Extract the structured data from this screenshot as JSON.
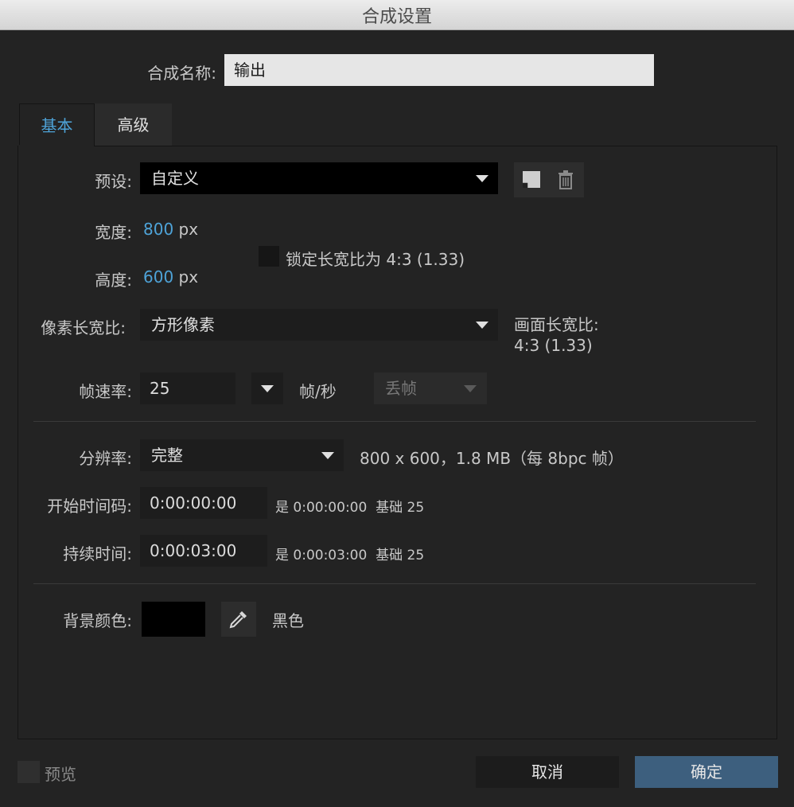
{
  "window": {
    "title": "合成设置"
  },
  "comp_name": {
    "label": "合成名称:",
    "value": "输出"
  },
  "tabs": [
    {
      "label": "基本",
      "active": true
    },
    {
      "label": "高级",
      "active": false
    }
  ],
  "preset": {
    "label": "预设:",
    "value": "自定义",
    "icons": [
      "save-preset-icon",
      "trash-icon"
    ]
  },
  "width": {
    "label": "宽度:",
    "value": "800",
    "unit": "px"
  },
  "height": {
    "label": "高度:",
    "value": "600",
    "unit": "px"
  },
  "lock_aspect": {
    "label": "锁定长宽比为 4:3 (1.33)",
    "checked": false
  },
  "pixel_aspect": {
    "label": "像素长宽比:",
    "value": "方形像素"
  },
  "frame_aspect": {
    "label": "画面长宽比:",
    "value": "4:3 (1.33)"
  },
  "frame_rate": {
    "label": "帧速率:",
    "value": "25",
    "unit": "帧/秒",
    "drop_frame": "丢帧"
  },
  "resolution": {
    "label": "分辨率:",
    "value": "完整",
    "info": "800 x 600，1.8 MB（每 8bpc 帧）"
  },
  "start_timecode": {
    "label": "开始时间码:",
    "value": "0:00:00:00",
    "info_is": "是 0:00:00:00",
    "info_base": "基础 25"
  },
  "duration": {
    "label": "持续时间:",
    "value": "0:00:03:00",
    "info_is": "是 0:00:03:00",
    "info_base": "基础 25"
  },
  "background": {
    "label": "背景颜色:",
    "color": "#000000",
    "color_name": "黑色"
  },
  "preview": {
    "label": "预览",
    "checked": false
  },
  "buttons": {
    "cancel": "取消",
    "ok": "确定"
  },
  "colors": {
    "accent": "#4ea3d8",
    "ok_button": "#3d5f7e",
    "background": "#232323"
  }
}
